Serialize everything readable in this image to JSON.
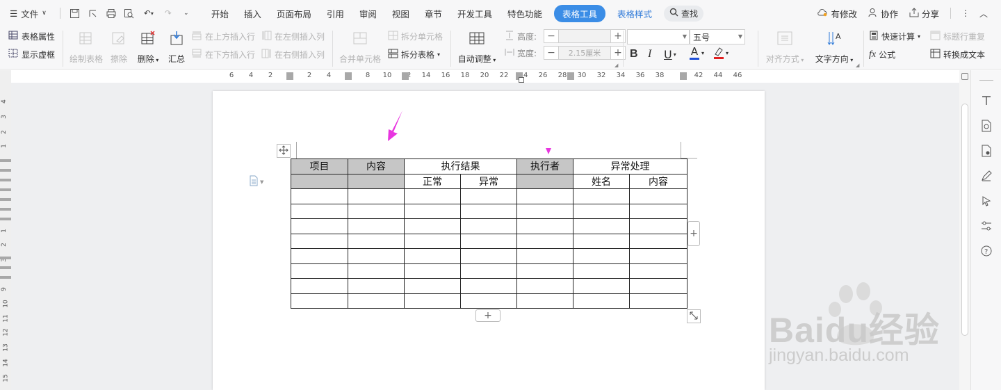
{
  "menubar": {
    "file_label": "文件",
    "tabs": [
      "开始",
      "插入",
      "页面布局",
      "引用",
      "审阅",
      "视图",
      "章节",
      "开发工具",
      "特色功能"
    ],
    "active_tab": "表格工具",
    "style_tab": "表格样式",
    "search_label": "查找",
    "changed_label": "有修改",
    "collab_label": "协作",
    "share_label": "分享"
  },
  "ribbon": {
    "table_props": "表格属性",
    "show_grid": "显示虚框",
    "draw_table": "绘制表格",
    "erase": "擦除",
    "delete": "删除",
    "summary": "汇总",
    "insert_row_above": "在上方插入行",
    "insert_row_below": "在下方插入行",
    "insert_col_left": "在左侧插入列",
    "insert_col_right": "在右侧插入列",
    "merge_cells": "合并单元格",
    "split_cells": "拆分单元格",
    "split_table": "拆分表格",
    "auto_adjust": "自动调整",
    "height_label": "高度:",
    "height_value": "",
    "width_label": "宽度:",
    "width_value": "2.15厘米",
    "font_name": "",
    "font_size": "五号",
    "align": "对齐方式",
    "text_direction": "文字方向",
    "quick_calc": "快速计算",
    "repeat_header": "标题行重复",
    "formula": "公式",
    "to_text": "转换成文本",
    "font_color": "#1f4fd8",
    "highlight_color": "#e02020"
  },
  "ruler": {
    "h_ticks": [
      "6",
      "4",
      "2",
      "2",
      "4",
      "8",
      "10",
      "12",
      "14",
      "16",
      "18",
      "20",
      "22",
      "24",
      "26",
      "28",
      "30",
      "32",
      "34",
      "36",
      "38",
      "42",
      "44",
      "46"
    ],
    "v_ticks": [
      "4",
      "3",
      "2",
      "1",
      "1",
      "2",
      "3",
      "9",
      "10",
      "11",
      "12",
      "13",
      "14",
      "15"
    ]
  },
  "table": {
    "header_row1": [
      "项目",
      "内容",
      "执行结果",
      "执行者",
      "异常处理"
    ],
    "header_row2": [
      "正常",
      "异常",
      "姓名",
      "内容"
    ],
    "shaded_color": "#c6c6c6",
    "empty_rows": 8
  },
  "annotations": {
    "arrow_color": "#e836e0"
  },
  "watermark": {
    "brand": "Baidu经验",
    "url": "jingyan.baidu.com"
  }
}
